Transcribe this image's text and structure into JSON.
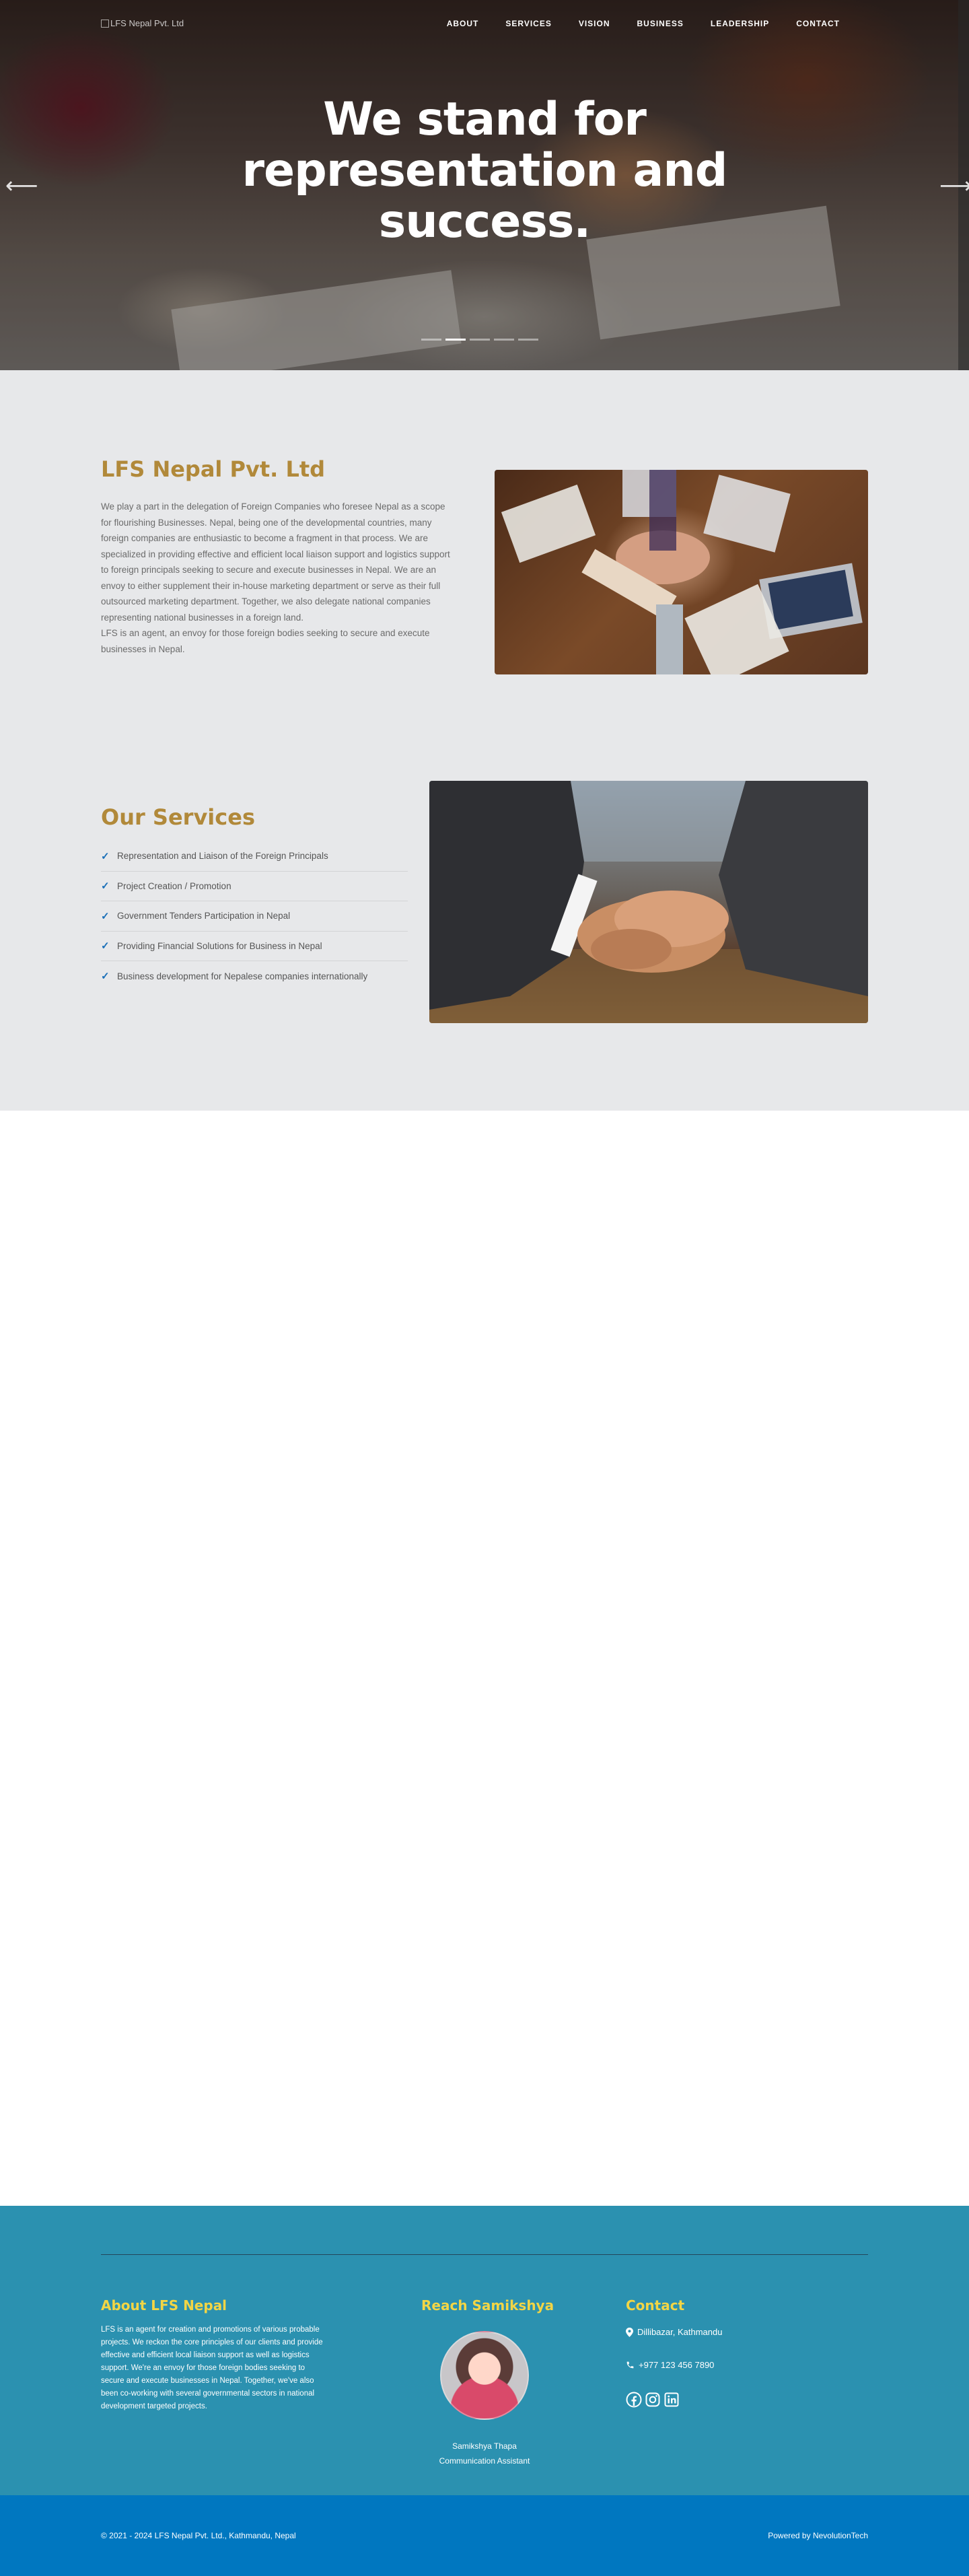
{
  "nav": {
    "logo_alt": "LFS Nepal Pvt. Ltd",
    "links": [
      "ABOUT",
      "SERVICES",
      "VISION",
      "BUSINESS",
      "LEADERSHIP",
      "CONTACT"
    ]
  },
  "hero": {
    "headline": "We stand for representation and success.",
    "slide_count": 5,
    "active_slide": 2
  },
  "about": {
    "title": "LFS Nepal Pvt. Ltd",
    "paragraph_1": "We play a part in the delegation of Foreign Companies who foresee Nepal as a scope for flourishing Businesses. Nepal, being one of the developmental countries, many foreign companies are enthusiastic to become a fragment in that process. We are specialized in providing effective and efficient local liaison support and logistics support to foreign principals seeking to secure and execute businesses in Nepal. We are an envoy to either supplement their in-house marketing department or serve as their full outsourced marketing department. Together, we also delegate national companies representing national businesses in a foreign land.",
    "paragraph_2": "LFS is an agent, an envoy for those foreign bodies seeking to secure and execute businesses in Nepal."
  },
  "services": {
    "title": "Our Services",
    "items": [
      "Representation and Liaison of the Foreign Principals",
      "Project Creation / Promotion",
      "Government Tenders Participation in Nepal",
      "Providing Financial Solutions for Business in Nepal",
      "Business development for Nepalese companies internationally"
    ]
  },
  "footer": {
    "about_title": "About LFS Nepal",
    "about_text": "LFS is an agent for creation and promotions of various probable projects. We reckon the core principles of our clients and provide effective and efficient local liaison support as well as logistics support. We're an envoy for those foreign bodies seeking to secure and execute businesses in Nepal. Together, we've also been co-working with several governmental sectors in national development targeted projects.",
    "reach_title": "Reach Samikshya",
    "person_name": "Samikshya Thapa",
    "person_role": "Communication Assistant",
    "contact_title": "Contact",
    "address": "Dillibazar, Kathmandu",
    "phone": "+977 123 456 7890",
    "copyright": "© 2021 - 2024 LFS Nepal Pvt. Ltd., Kathmandu, Nepal",
    "powered_by": "Powered by NevolutionTech"
  },
  "colors": {
    "accent_gold": "#b1893a",
    "footer_heading": "#f2d545",
    "footer_bg": "#2b91b0",
    "bottom_bar_bg": "#0077c0",
    "check_blue": "#1a6fb8"
  },
  "icons": [
    "arrow-left-icon",
    "arrow-right-icon",
    "check-icon",
    "map-marker-icon",
    "phone-icon",
    "facebook-icon",
    "instagram-icon",
    "linkedin-icon"
  ]
}
